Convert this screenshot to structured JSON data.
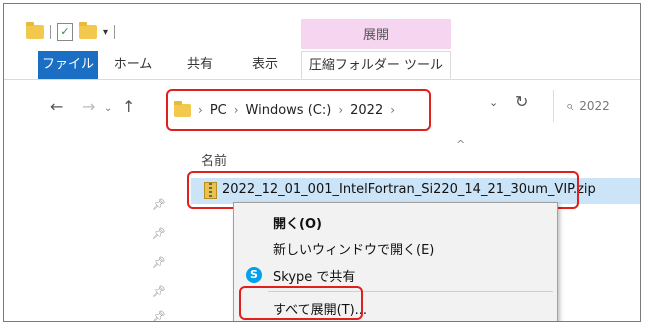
{
  "ribbon": {
    "context_title": "展開",
    "tabs": [
      {
        "label": "ファイル"
      },
      {
        "label": "ホーム"
      },
      {
        "label": "共有"
      },
      {
        "label": "表示"
      },
      {
        "label": "圧縮フォルダー ツール"
      }
    ]
  },
  "address": {
    "segments": [
      "PC",
      "Windows (C:)",
      "2022"
    ],
    "separator": "›",
    "search_text": "2022"
  },
  "list": {
    "column_name": "名前",
    "file": "2022_12_01_001_IntelFortran_Si220_14_21_30um_VIP.zip"
  },
  "context_menu": {
    "items": [
      {
        "label": "開く(O)"
      },
      {
        "label": "新しいウィンドウで開く(E)"
      },
      {
        "label": "Skype で共有"
      },
      {
        "label": "すべて展開(T)..."
      }
    ]
  },
  "colors": {
    "file_tab": "#1a6fc4",
    "context_band": "#f6d5f0",
    "highlight": "#e0201c",
    "selected_row": "#cce4f7"
  }
}
